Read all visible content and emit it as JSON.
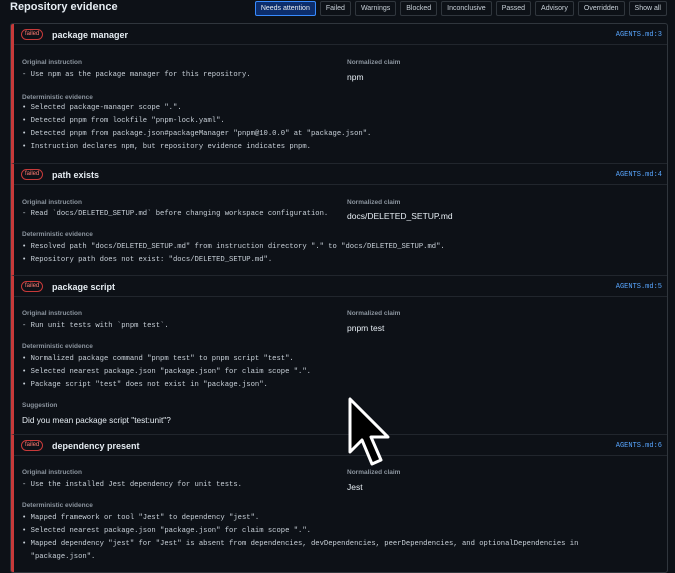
{
  "header": {
    "title": "Repository evidence",
    "filters": [
      "Needs attention",
      "Failed",
      "Warnings",
      "Blocked",
      "Inconclusive",
      "Passed",
      "Advisory",
      "Overridden",
      "Show all"
    ],
    "active_filter": "Needs attention"
  },
  "labels": {
    "original_instruction": "Original instruction",
    "normalized_claim": "Normalized claim",
    "deterministic_evidence": "Deterministic evidence",
    "suggestion": "Suggestion"
  },
  "colors": {
    "accent": "#388bfd",
    "failed": "#ff7b72",
    "link": "#58a6ff"
  },
  "cards": [
    {
      "status": "failed",
      "title": "package manager",
      "location": "AGENTS.md:3",
      "instruction": "- Use npm as the package manager for this repository.",
      "claim": "npm",
      "evidence": [
        "• Selected package-manager scope \".\".",
        "• Detected pnpm from lockfile \"pnpm-lock.yaml\".",
        "• Detected pnpm from package.json#packageManager \"pnpm@10.0.0\" at \"package.json\".",
        "• Instruction declares npm, but repository evidence indicates pnpm."
      ]
    },
    {
      "status": "failed",
      "title": "path exists",
      "location": "AGENTS.md:4",
      "instruction": "- Read `docs/DELETED_SETUP.md` before changing workspace configuration.",
      "claim": "docs/DELETED_SETUP.md",
      "evidence": [
        "• Resolved path \"docs/DELETED_SETUP.md\" from instruction directory \".\" to \"docs/DELETED_SETUP.md\".",
        "• Repository path does not exist: \"docs/DELETED_SETUP.md\"."
      ]
    },
    {
      "status": "failed",
      "title": "package script",
      "location": "AGENTS.md:5",
      "instruction": "- Run unit tests with `pnpm test`.",
      "claim": "pnpm test",
      "evidence": [
        "• Normalized package command \"pnpm test\" to pnpm script \"test\".",
        "• Selected nearest package.json \"package.json\" for claim scope \".\".",
        "• Package script \"test\" does not exist in \"package.json\"."
      ],
      "suggestion": "Did you mean package script \"test:unit\"?"
    },
    {
      "status": "failed",
      "title": "dependency present",
      "location": "AGENTS.md:6",
      "instruction": "- Use the installed Jest dependency for unit tests.",
      "claim": "Jest",
      "evidence": [
        "• Mapped framework or tool \"Jest\" to dependency \"jest\".",
        "• Selected nearest package.json \"package.json\" for claim scope \".\".",
        "• Mapped dependency \"jest\" for \"Jest\" is absent from dependencies, devDependencies, peerDependencies, and optionalDependencies in",
        "  \"package.json\"."
      ]
    }
  ]
}
